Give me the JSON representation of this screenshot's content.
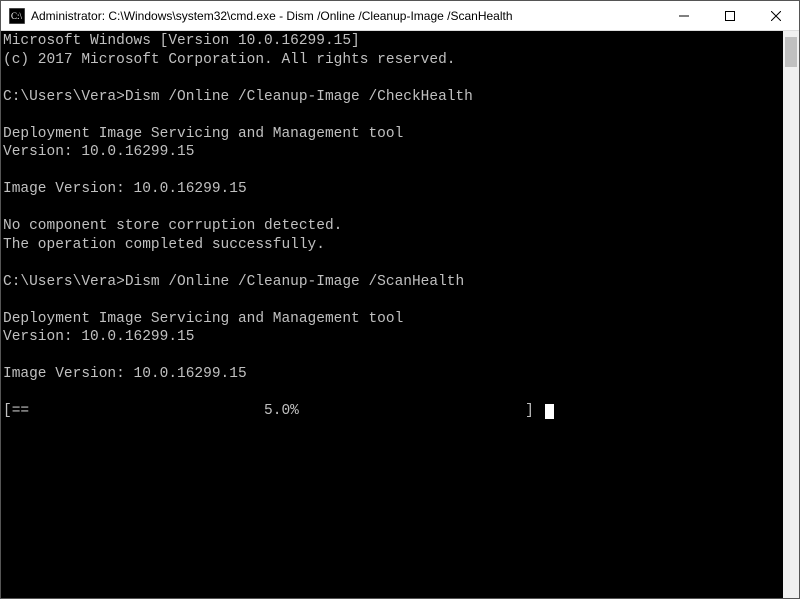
{
  "titlebar": {
    "title": "Administrator: C:\\Windows\\system32\\cmd.exe - Dism  /Online /Cleanup-Image /ScanHealth"
  },
  "window_controls": {
    "minimize": "Minimize",
    "maximize": "Maximize",
    "close": "Close"
  },
  "console": {
    "line1": "Microsoft Windows [Version 10.0.16299.15]",
    "line2": "(c) 2017 Microsoft Corporation. All rights reserved.",
    "blank1": "",
    "prompt1": "C:\\Users\\Vera>Dism /Online /Cleanup-Image /CheckHealth",
    "blank2": "",
    "tool1": "Deployment Image Servicing and Management tool",
    "ver1": "Version: 10.0.16299.15",
    "blank3": "",
    "imgver1": "Image Version: 10.0.16299.15",
    "blank4": "",
    "nocorrupt": "No component store corruption detected.",
    "opok": "The operation completed successfully.",
    "blank5": "",
    "prompt2": "C:\\Users\\Vera>Dism /Online /Cleanup-Image /ScanHealth",
    "blank6": "",
    "tool2": "Deployment Image Servicing and Management tool",
    "ver2": "Version: 10.0.16299.15",
    "blank7": "",
    "imgver2": "Image Version: 10.0.16299.15",
    "blank8": "",
    "progress": "[==                           5.0%                          ] "
  }
}
